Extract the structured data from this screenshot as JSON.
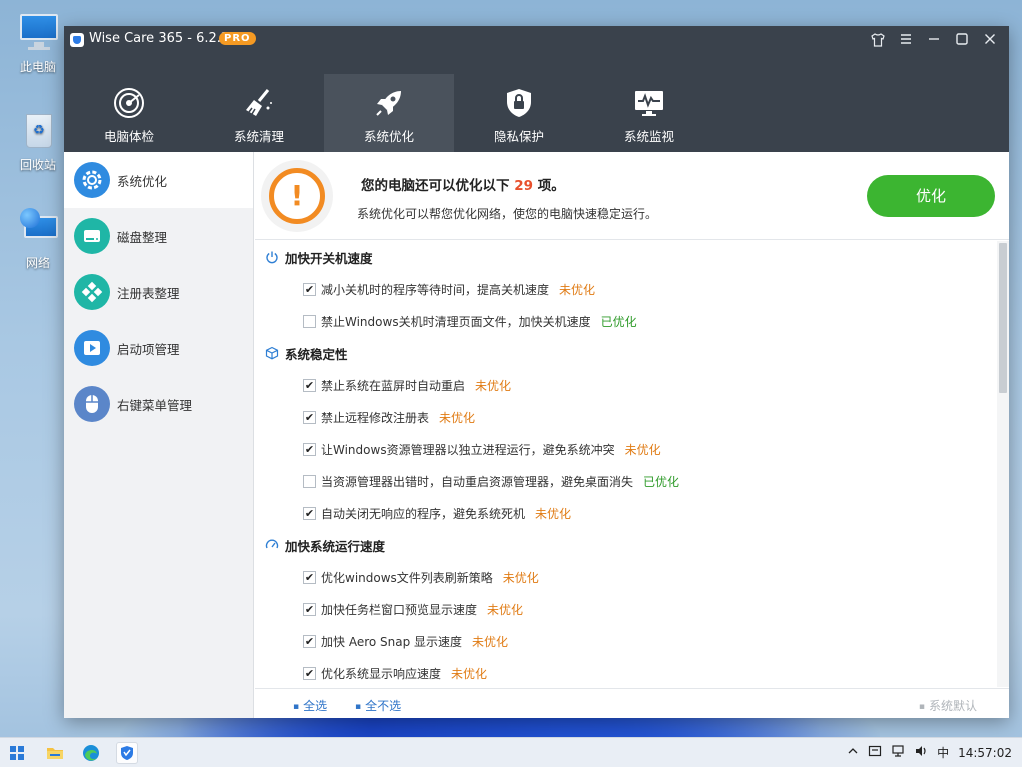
{
  "desktop": {
    "icons": [
      {
        "label": "此电脑",
        "icon": "computer-icon"
      },
      {
        "label": "回收站",
        "icon": "recycle-bin-icon"
      },
      {
        "label": "网络",
        "icon": "network-icon"
      }
    ]
  },
  "window": {
    "title": "Wise Care 365 - 6.2.2",
    "badge": "PRO",
    "buttons": {
      "skin": "shirt-icon",
      "menu": "menu-icon",
      "minimize": "minimize-icon",
      "maximize": "maximize-icon",
      "close": "close-icon"
    }
  },
  "tabs": [
    {
      "label": "电脑体检",
      "icon": "radar-icon",
      "active": false
    },
    {
      "label": "系统清理",
      "icon": "broom-icon",
      "active": false
    },
    {
      "label": "系统优化",
      "icon": "rocket-icon",
      "active": true
    },
    {
      "label": "隐私保护",
      "icon": "shield-lock-icon",
      "active": false
    },
    {
      "label": "系统监视",
      "icon": "monitor-pulse-icon",
      "active": false
    }
  ],
  "sidebar": {
    "items": [
      {
        "label": "系统优化",
        "icon": "gear-icon",
        "color": "#2f8be0",
        "active": true
      },
      {
        "label": "磁盘整理",
        "icon": "disk-icon",
        "color": "#1fb6a6",
        "active": false
      },
      {
        "label": "注册表整理",
        "icon": "registry-icon",
        "color": "#1fb6a6",
        "active": false
      },
      {
        "label": "启动项管理",
        "icon": "play-icon",
        "color": "#2f8be0",
        "active": false
      },
      {
        "label": "右键菜单管理",
        "icon": "mouse-icon",
        "color": "#5b86c9",
        "active": false
      }
    ]
  },
  "banner": {
    "headline_prefix": "您的电脑还可以优化以下",
    "headline_count": "29",
    "headline_suffix": "项。",
    "subtitle": "系统优化可以帮您优化网络，使您的电脑快速稳定运行。",
    "button": "优化"
  },
  "sections": [
    {
      "title": "加快开关机速度",
      "icon": "power-icon",
      "rows": [
        {
          "text": "减小关机时的程序等待时间，提高关机速度",
          "checked": true,
          "status": "未优化"
        },
        {
          "text": "禁止Windows关机时清理页面文件，加快关机速度",
          "checked": false,
          "status": "已优化"
        }
      ]
    },
    {
      "title": "系统稳定性",
      "icon": "cube-icon",
      "rows": [
        {
          "text": "禁止系统在蓝屏时自动重启",
          "checked": true,
          "status": "未优化"
        },
        {
          "text": "禁止远程修改注册表",
          "checked": true,
          "status": "未优化"
        },
        {
          "text": "让Windows资源管理器以独立进程运行，避免系统冲突",
          "checked": true,
          "status": "未优化"
        },
        {
          "text": "当资源管理器出错时，自动重启资源管理器，避免桌面消失",
          "checked": false,
          "status": "已优化"
        },
        {
          "text": "自动关闭无响应的程序，避免系统死机",
          "checked": true,
          "status": "未优化"
        }
      ]
    },
    {
      "title": "加快系统运行速度",
      "icon": "speedometer-icon",
      "rows": [
        {
          "text": "优化windows文件列表刷新策略",
          "checked": true,
          "status": "未优化"
        },
        {
          "text": "加快任务栏窗口预览显示速度",
          "checked": true,
          "status": "未优化"
        },
        {
          "text": "加快 Aero Snap 显示速度",
          "checked": true,
          "status": "未优化"
        },
        {
          "text": "优化系统显示响应速度",
          "checked": true,
          "status": "未优化"
        }
      ]
    }
  ],
  "footer": {
    "select_all": "全选",
    "select_none": "全不选",
    "default": "系统默认"
  },
  "taskbar": {
    "apps": [
      "start-icon",
      "file-explorer-icon",
      "edge-icon",
      "wise-care-icon"
    ],
    "tray": {
      "ime": "中",
      "time": "14:57:02"
    }
  }
}
